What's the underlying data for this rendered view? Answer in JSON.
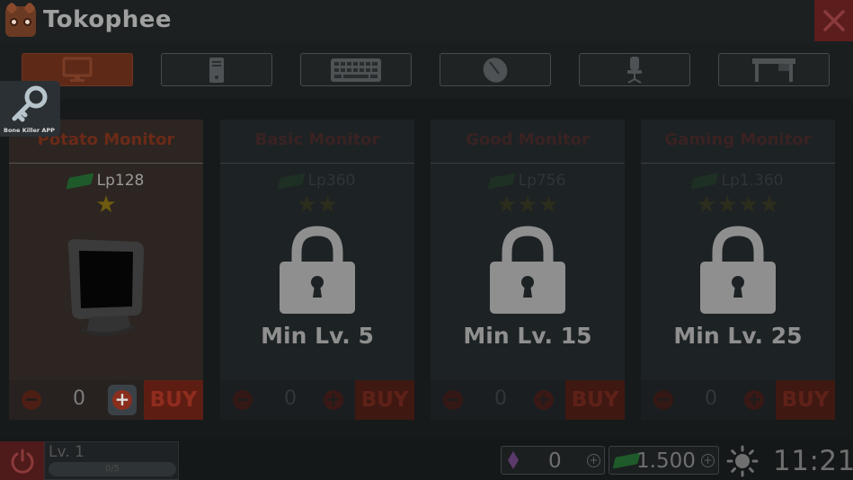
{
  "app": {
    "title": "Tokophee",
    "overlay_label": "Bone Killer APP"
  },
  "tabs": [
    {
      "icon": "monitor-icon",
      "active": true
    },
    {
      "icon": "pc-tower-icon",
      "active": false
    },
    {
      "icon": "keyboard-icon",
      "active": false
    },
    {
      "icon": "mouse-icon",
      "active": false
    },
    {
      "icon": "chair-icon",
      "active": false
    },
    {
      "icon": "desk-icon",
      "active": false
    }
  ],
  "cards": [
    {
      "title": "Potato Monitor",
      "price": "Lp128",
      "stars": "★",
      "locked": false,
      "min_level": "",
      "qty": "0",
      "buy_label": "BUY"
    },
    {
      "title": "Basic Monitor",
      "price": "Lp360",
      "stars": "★★",
      "locked": true,
      "min_level": "Min Lv. 5",
      "qty": "0",
      "buy_label": "BUY"
    },
    {
      "title": "Good Monitor",
      "price": "Lp756",
      "stars": "★★★",
      "locked": true,
      "min_level": "Min Lv. 15",
      "qty": "0",
      "buy_label": "BUY"
    },
    {
      "title": "Gaming Monitor",
      "price": "Lp1.360",
      "stars": "★★★★",
      "locked": true,
      "min_level": "Min Lv. 25",
      "qty": "0",
      "buy_label": "BUY"
    }
  ],
  "status": {
    "level": "Lv. 1",
    "xp": "0/5",
    "gems": "0",
    "cash": "1.500",
    "time": "11:21"
  },
  "colors": {
    "accent": "#5e2a17",
    "close": "#5c1d1d",
    "buy": "#5e1d13"
  }
}
